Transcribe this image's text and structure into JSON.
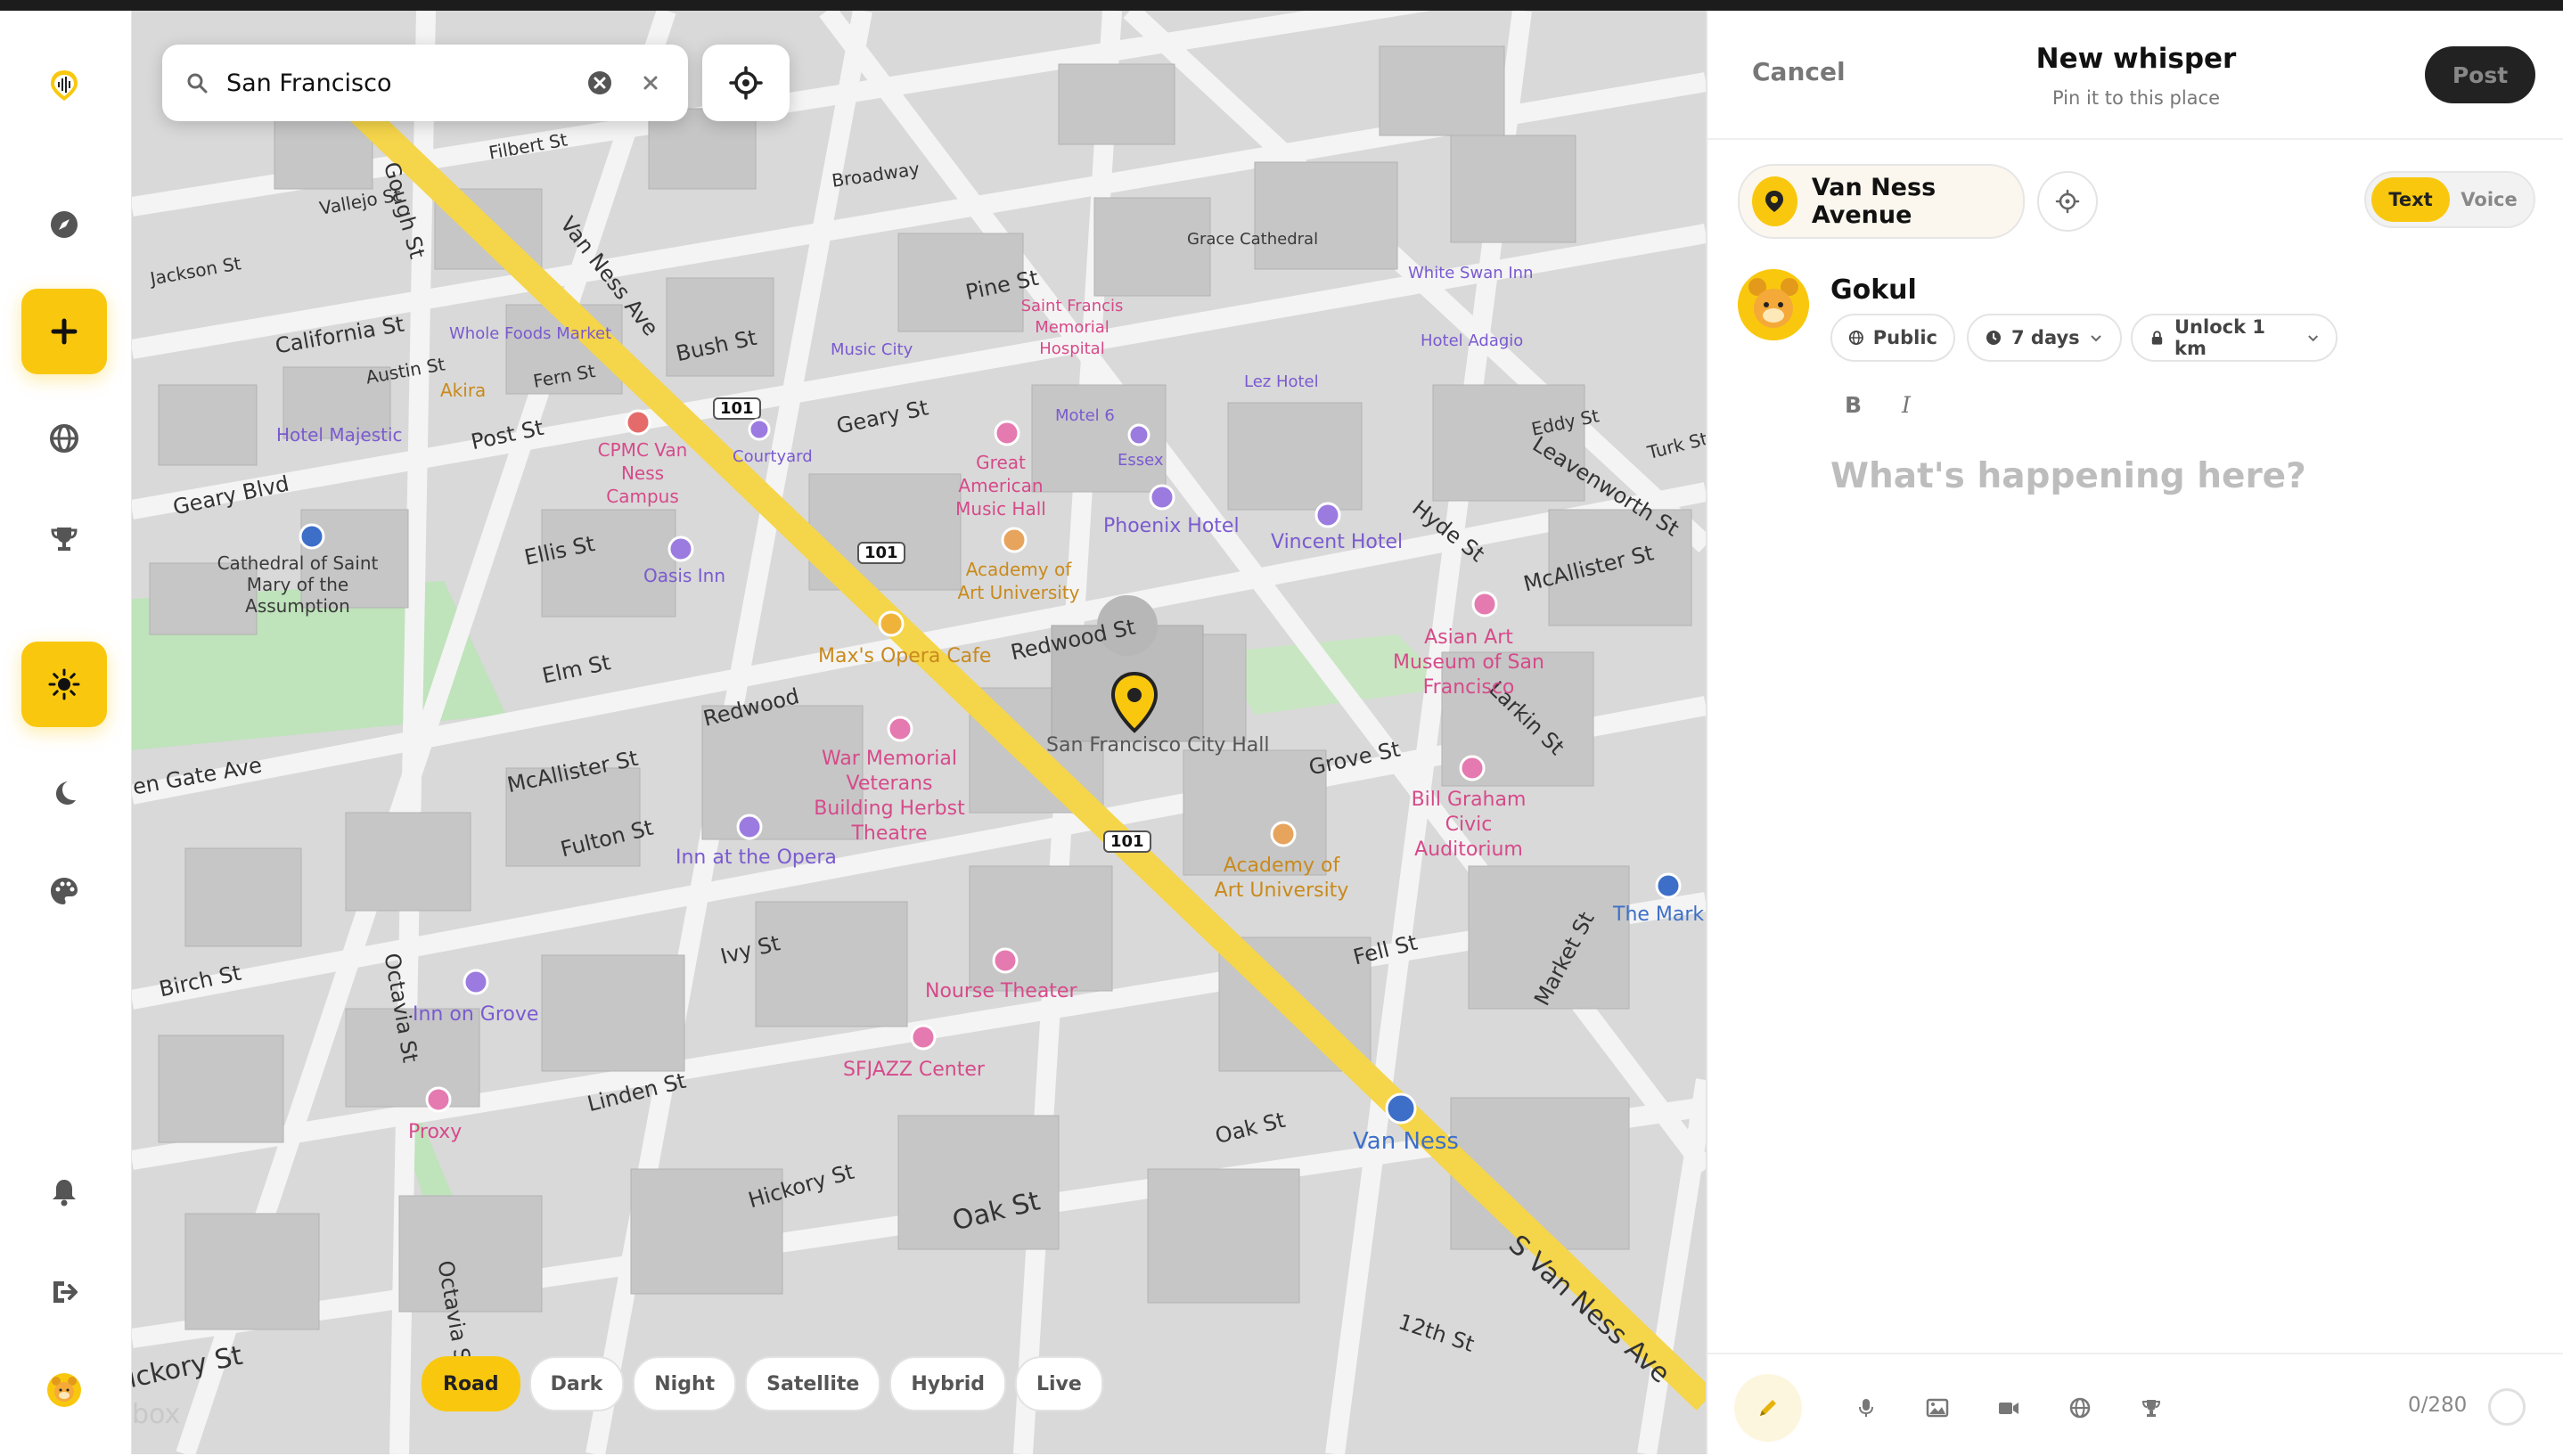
{
  "search": {
    "value": "San Francisco"
  },
  "map": {
    "styles": [
      {
        "label": "Road",
        "active": true
      },
      {
        "label": "Dark",
        "active": false
      },
      {
        "label": "Night",
        "active": false
      },
      {
        "label": "Satellite",
        "active": false
      },
      {
        "label": "Hybrid",
        "active": false
      },
      {
        "label": "Live",
        "active": false
      }
    ],
    "selected_place": "San Francisco City Hall",
    "watermark": "box",
    "highway_shield": "101",
    "streets": {
      "van_ness_ave": "Van Ness Ave",
      "s_van_ness_ave": "S Van Ness Ave",
      "geary_blvd": "Geary Blvd",
      "golden_gate_ave": "en Gate Ave",
      "fulton_st": "Fulton St",
      "mcallister_st": "McAllister St",
      "grove_st": "Grove St",
      "fell_st": "Fell St",
      "oak_st": "Oak St",
      "oak_st2": "Oak St",
      "hickory_st": "Hickory St",
      "hickory_st2": "ickory St",
      "linden_st": "Linden St",
      "ivy_st": "Ivy St",
      "birch_st": "Birch St",
      "octavia_st": "Octavia St",
      "octavia_st2": "Octavia St",
      "gough_st": "Gough St",
      "elm_st": "Elm St",
      "redwood": "Redwood",
      "redwood_st": "Redwood St",
      "ellis_st": "Ellis St",
      "post_st": "Post St",
      "bush_st": "Bush St",
      "pine_st": "Pine St",
      "geary_st": "Geary St",
      "larkin_st": "Larkin St",
      "hyde_st": "Hyde St",
      "leavenworth_st": "Leavenworth St",
      "market_st": "Market St",
      "twelfth_st": "12th St",
      "california_st": "California St",
      "fern_st": "Fern St",
      "austin_st": "Austin St",
      "vallejo_st": "Vallejo St",
      "jackson_st": "Jackson St",
      "filbert_st": "Filbert St",
      "broadway": "Broadway",
      "mcallister_st2": "McAllister St",
      "eddy_st": "Eddy St",
      "turk_st": "Turk St"
    },
    "pois": {
      "war_memorial": "War Memorial Veterans Building Herbst Theatre",
      "inn_opera": "Inn at the Opera",
      "inn_grove": "Inn on Grove",
      "nourse": "Nourse Theater",
      "sfjazz": "SFJAZZ Center",
      "proxy": "Proxy",
      "max_opera": "Max's Opera Cafe",
      "academy1": "Academy of Art University",
      "academy2": "Academy of Art University",
      "bill_graham": "Bill Graham Civic Auditorium",
      "asian_art": "Asian Art Museum of San Francisco",
      "phoenix": "Phoenix Hotel",
      "vincent": "Vincent Hotel",
      "great_american": "Great American Music Hall",
      "oasis": "Oasis Inn",
      "cpmc": "CPMC Van Ness Campus",
      "cathedral": "Cathedral of Saint Mary of the Assumption",
      "hotel_majestic": "Hotel Majestic",
      "whole_foods": "Whole Foods Market",
      "akira": "Akira",
      "courtyard": "Courtyard",
      "van_ness_station": "Van Ness",
      "the_market": "The Mark",
      "essex": "Essex",
      "motel6": "Motel 6",
      "st_francis": "Saint Francis Memorial Hospital",
      "music_city": "Music City",
      "hotel_adagio": "Hotel Adagio",
      "white_swan": "White Swan Inn",
      "grace": "Grace Cathedral",
      "lez_hotel": "Lez Hotel"
    }
  },
  "panel": {
    "cancel": "Cancel",
    "title": "New whisper",
    "subtitle": "Pin it to this place",
    "post": "Post",
    "place": "Van Ness Avenue",
    "modes": [
      {
        "label": "Text",
        "active": true
      },
      {
        "label": "Voice",
        "active": false
      }
    ],
    "user": "Gokul",
    "visibility": "Public",
    "duration": "7 days",
    "unlock": "Unlock 1 km",
    "bold": "B",
    "italic": "I",
    "placeholder": "What's happening here?",
    "counter": "0/280"
  },
  "colors": {
    "accent": "#f9c80e",
    "dark": "#222222"
  }
}
